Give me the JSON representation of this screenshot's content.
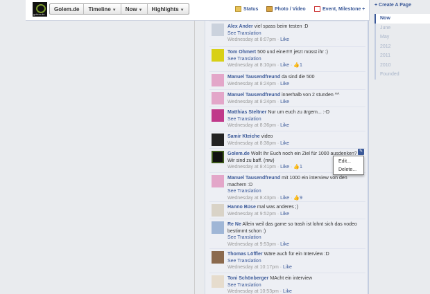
{
  "header": {
    "page_name": "Golem.de",
    "logo_text": "golem.de",
    "tabs": [
      {
        "label": "Golem.de",
        "caret": false
      },
      {
        "label": "Timeline",
        "caret": true
      },
      {
        "label": "Now",
        "caret": true
      },
      {
        "label": "Highlights",
        "caret": true
      }
    ],
    "composer": {
      "status_label": "Status",
      "photo_label": "Photo / Video",
      "event_label": "Event, Milestone +"
    }
  },
  "rightnav": {
    "create_page_label": "+ Create A Page",
    "years": [
      "Now",
      "June",
      "May",
      "2012",
      "2011",
      "2010",
      "Founded"
    ],
    "active_year": "Now"
  },
  "comments": [
    {
      "name": "Alex Ander",
      "text": "viel spass beim testen :D",
      "see_translation": "See Translation",
      "time": "Wednesday at 8:07pm",
      "like": "Like",
      "likes": "",
      "avatar": "default"
    },
    {
      "name": "Tom Ohmert",
      "text": "500 und einer!!!! jetzt müsst ihr :)",
      "see_translation": "See Translation",
      "time": "Wednesday at 8:10pm",
      "like": "Like",
      "likes": "1",
      "avatar": "yellow"
    },
    {
      "name": "Manuel Tausendfreund",
      "text": "da sind die 500",
      "see_translation": "",
      "time": "Wednesday at 8:24pm",
      "like": "Like",
      "likes": "",
      "avatar": "pink"
    },
    {
      "name": "Manuel Tausendfreund",
      "text": "innerhalb von 2 stunden ^^",
      "see_translation": "",
      "time": "Wednesday at 8:24pm",
      "like": "Like",
      "likes": "",
      "avatar": "pink"
    },
    {
      "name": "Matthias Steltner",
      "text": "Nur um euch zu ärgern... :-D",
      "see_translation": "See Translation",
      "time": "Wednesday at 8:36pm",
      "like": "Like",
      "likes": "",
      "avatar": "magenta"
    },
    {
      "name": "Samir Kteiche",
      "text": "video",
      "see_translation": "",
      "time": "Wednesday at 8:38pm",
      "like": "Like",
      "likes": "",
      "avatar": "dark"
    },
    {
      "name": "Golem.de",
      "text": "Wollt Ihr Euch noch ein Ziel für 1000 ausdenken? Wir sind zu baff. (mw)",
      "see_translation": "",
      "time": "Wednesday at 8:41pm",
      "like": "Like",
      "likes": "1",
      "avatar": "golem"
    },
    {
      "name": "Manuel Tausendfreund",
      "text": "mit 1000 ein interview von den machern :D",
      "see_translation": "See Translation",
      "time": "Wednesday at 8:43pm",
      "like": "Like",
      "likes": "9",
      "avatar": "pink"
    },
    {
      "name": "Hanno Büse",
      "text": "mal was anderes ;)",
      "see_translation": "",
      "time": "Wednesday at 9:52pm",
      "like": "Like",
      "likes": "",
      "avatar": "face"
    },
    {
      "name": "Re Ne",
      "text": "Allein weil das game so trash ist lohnt sich das vodeo bestimmt schon :)",
      "see_translation": "See Translation",
      "time": "Wednesday at 9:53pm",
      "like": "Like",
      "likes": "",
      "avatar": "blueface"
    },
    {
      "name": "Thomas Löffler",
      "text": "Wäre auch für ein Interview :D",
      "see_translation": "See Translation",
      "time": "Wednesday at 10:17pm",
      "like": "Like",
      "likes": "",
      "avatar": "brown"
    },
    {
      "name": "Toni Schönberger",
      "text": "MAcht ein interview",
      "see_translation": "See Translation",
      "time": "Wednesday at 10:53pm",
      "like": "Like",
      "likes": "",
      "avatar": "pale"
    }
  ],
  "context_menu": {
    "edit_label": "Edit...",
    "delete_label": "Delete..."
  },
  "colors": {
    "link": "#3b5998",
    "background": "#e9ebee",
    "meta": "#999999"
  }
}
